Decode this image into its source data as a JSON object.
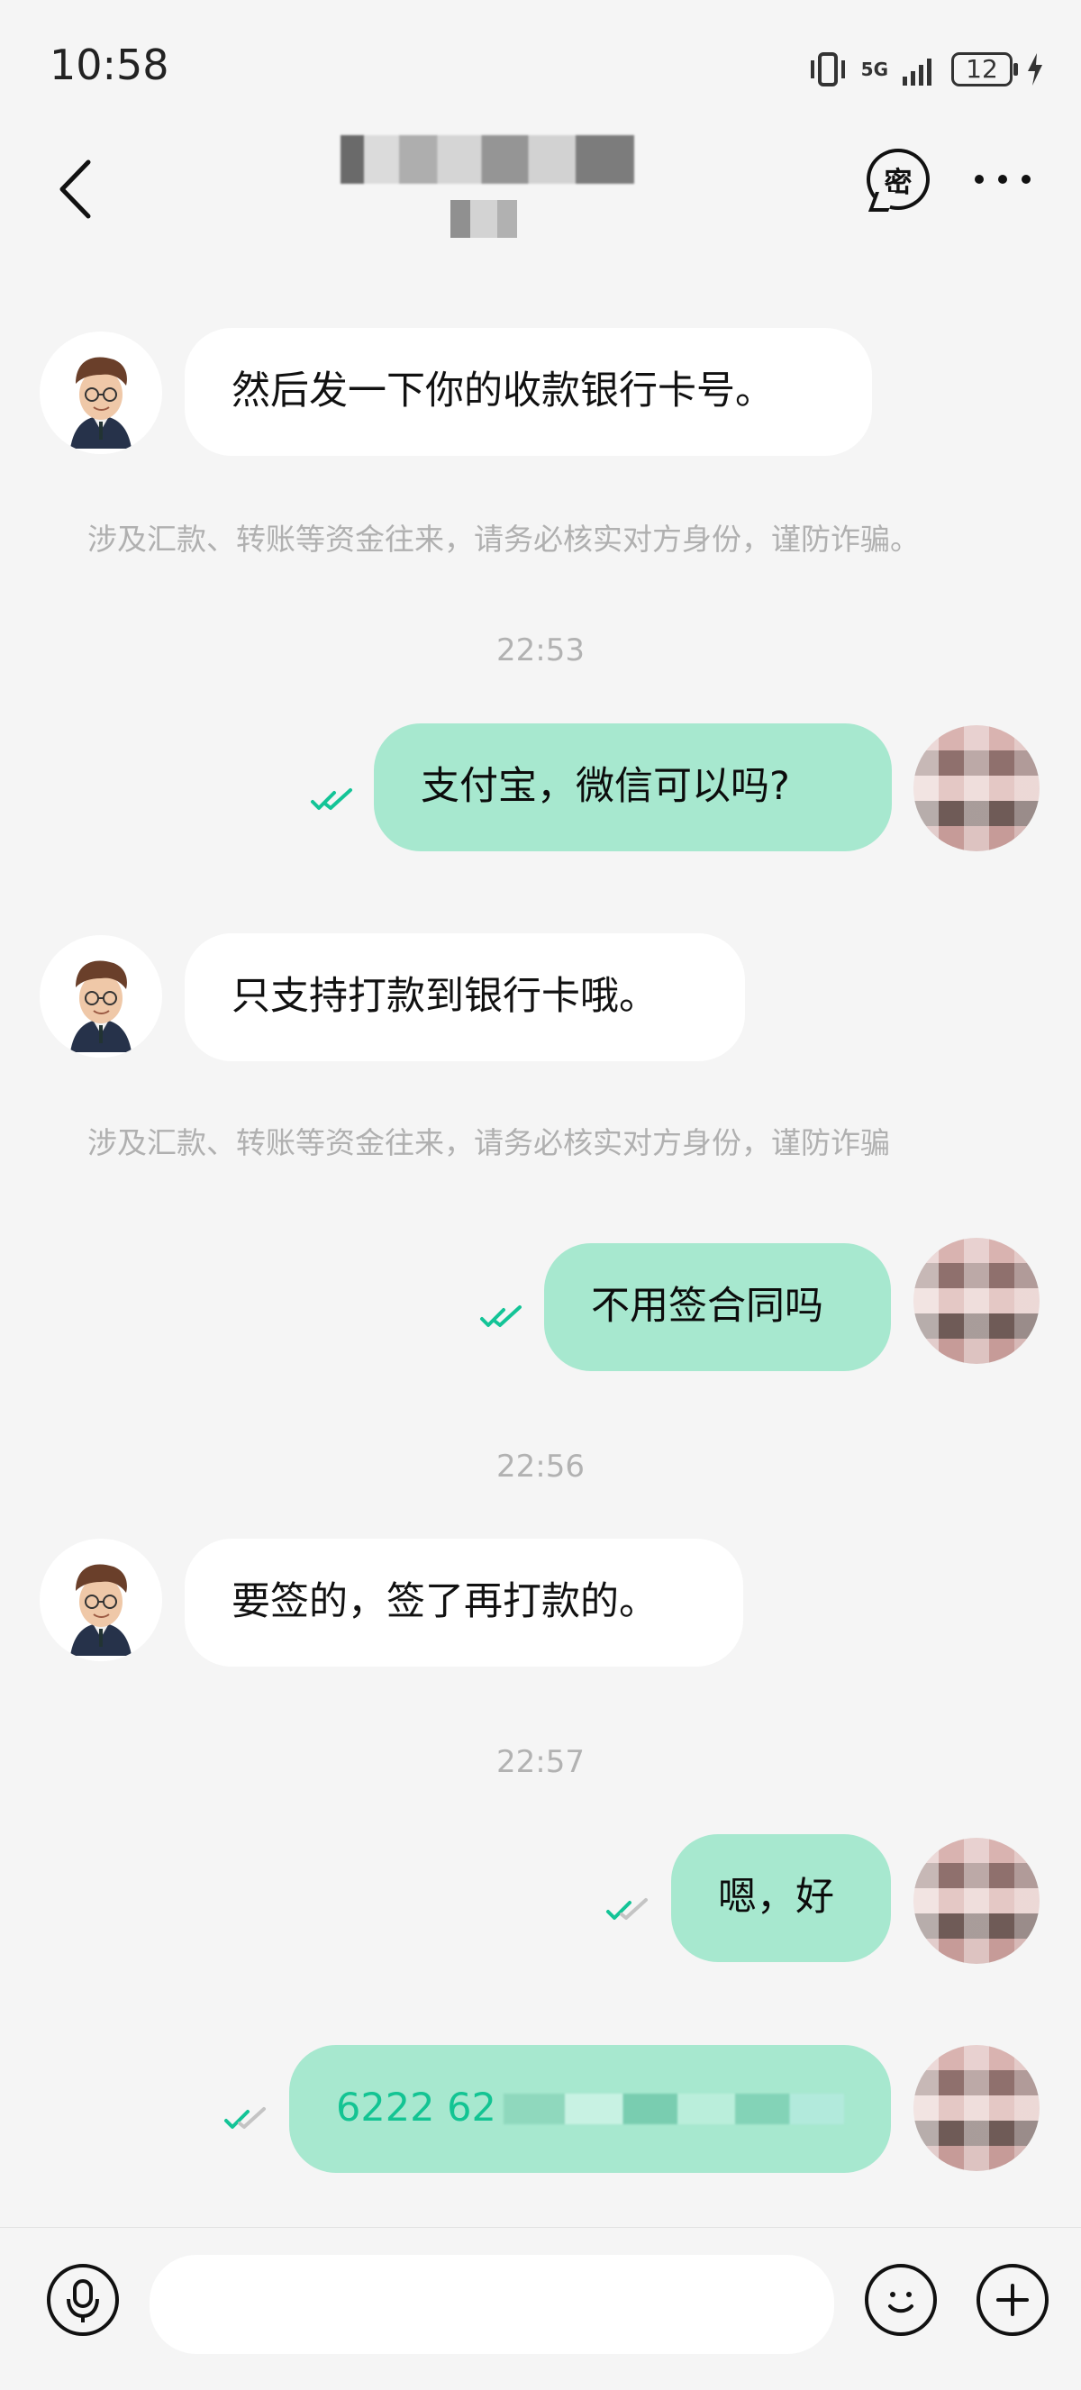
{
  "status": {
    "time": "10:58",
    "network": "5G",
    "battery": "12"
  },
  "header": {
    "actions": {
      "secret_label": "密"
    }
  },
  "notices": {
    "fund_warning_1": "涉及汇款、转账等资金往来，请务必核实对方身份，谨防诈骗。",
    "fund_warning_2": "涉及汇款、转账等资金往来，请务必核实对方身份，谨防诈骗"
  },
  "timestamps": [
    "22:53",
    "22:56",
    "22:57"
  ],
  "messages": [
    {
      "id": "m1",
      "side": "left",
      "text": "然后发一下你的收款银行卡号。"
    },
    {
      "id": "m2",
      "side": "right",
      "text": "支付宝，微信可以吗?"
    },
    {
      "id": "m3",
      "side": "left",
      "text": "只支持打款到银行卡哦。"
    },
    {
      "id": "m4",
      "side": "right",
      "text": "不用签合同吗"
    },
    {
      "id": "m5",
      "side": "left",
      "text": "要签的，签了再打款的。"
    },
    {
      "id": "m6",
      "side": "right",
      "text": "嗯，好"
    },
    {
      "id": "m7",
      "side": "right",
      "text": "6222 62"
    }
  ],
  "colors": {
    "background": "#f5f5f5",
    "incoming_bubble": "#ffffff",
    "outgoing_bubble": "#a7e8cf",
    "accent_green": "#13c493",
    "muted_text": "#b0b0b0"
  },
  "icons": {
    "back": "back-icon",
    "secret": "secret-chat-icon",
    "more": "more-icon",
    "voice": "microphone-icon",
    "emoji": "emoji-icon",
    "plus": "plus-icon",
    "read": "read-receipt-icon"
  },
  "input": {
    "placeholder": ""
  }
}
